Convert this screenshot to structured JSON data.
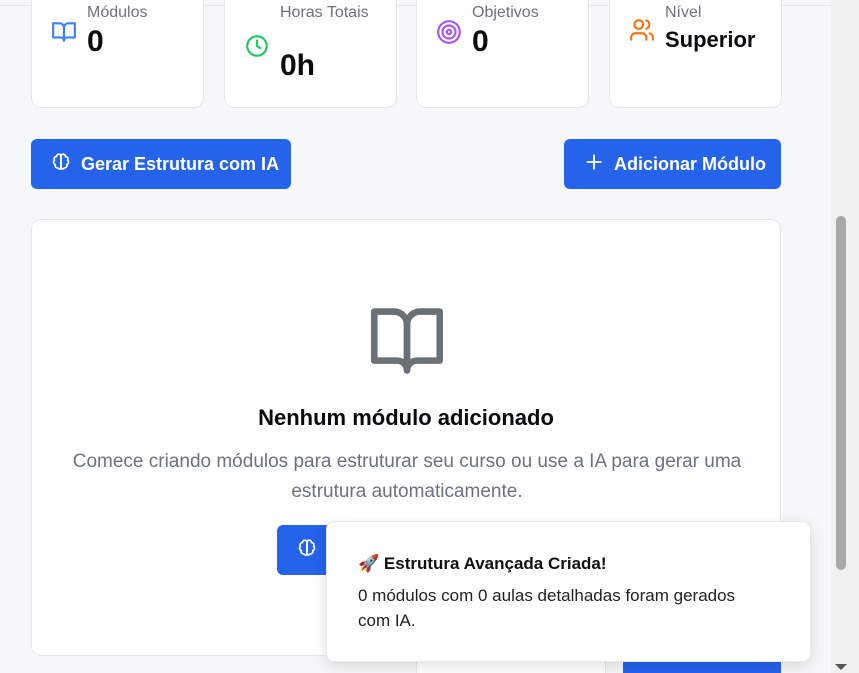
{
  "stats": [
    {
      "label": "Módulos",
      "value": "0",
      "icon": "book-open-icon",
      "color": "#3b82f6"
    },
    {
      "label": "Horas Totais",
      "value": "0h",
      "icon": "clock-icon",
      "color": "#22c55e"
    },
    {
      "label": "Objetivos",
      "value": "0",
      "icon": "target-icon",
      "color": "#a855f7"
    },
    {
      "label": "Nível",
      "value": "Superior",
      "icon": "users-icon",
      "color": "#f97316"
    }
  ],
  "actions": {
    "generate_label": "Gerar Estrutura com IA",
    "add_module_label": "Adicionar Módulo"
  },
  "empty_state": {
    "title": "Nenhum módulo adicionado",
    "description": "Comece criando módulos para estruturar seu curso ou use a IA para gerar uma estrutura automaticamente."
  },
  "toast": {
    "emoji": "🚀",
    "title": "Estrutura Avançada Criada!",
    "description": "0 módulos com 0 aulas detalhadas foram gerados com IA."
  },
  "colors": {
    "accent": "#2563eb"
  }
}
